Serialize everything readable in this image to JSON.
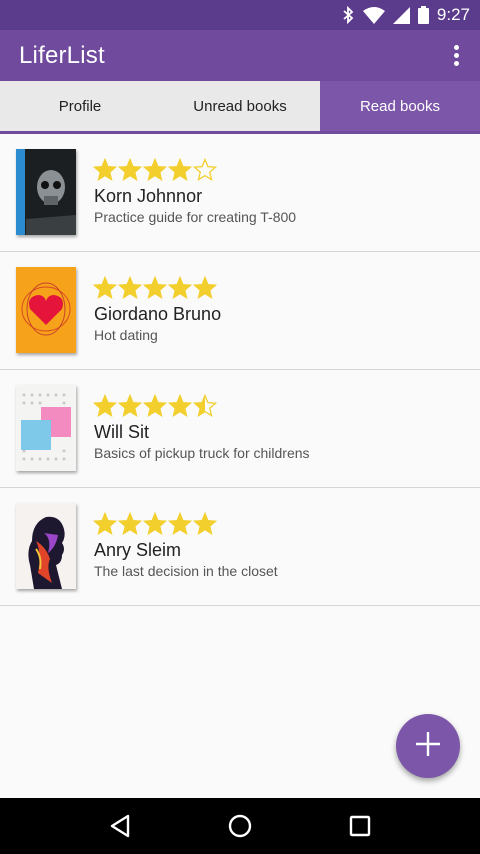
{
  "status_bar": {
    "time": "9:27",
    "icons": [
      "bluetooth-icon",
      "wifi-icon",
      "cell-signal-icon",
      "battery-icon"
    ]
  },
  "app_bar": {
    "title": "LiferList",
    "menu_icon": "more-vert-icon"
  },
  "tabs": [
    {
      "label": "Profile",
      "active": false
    },
    {
      "label": "Unread books",
      "active": false
    },
    {
      "label": "Read books",
      "active": true
    }
  ],
  "books": [
    {
      "rating": 4,
      "rating_max": 5,
      "author": "Korn Johnnor",
      "title": "Practice guide for creating T-800",
      "cover": "skull"
    },
    {
      "rating": 5,
      "rating_max": 5,
      "author": "Giordano Bruno",
      "title": "Hot dating",
      "cover": "heart"
    },
    {
      "rating": 4.5,
      "rating_max": 5,
      "author": "Will Sit",
      "title": "Basics of pickup truck for childrens",
      "cover": "squares"
    },
    {
      "rating": 5,
      "rating_max": 5,
      "author": "Anry Sleim",
      "title": "The last decision in the closet",
      "cover": "silhouette"
    }
  ],
  "fab": {
    "icon": "add-icon"
  },
  "nav_bar": {
    "icons": [
      "back-icon",
      "home-icon",
      "recents-icon"
    ]
  },
  "colors": {
    "status_bar": "#5b3b8c",
    "app_bar": "#6f4a9d",
    "active_tab": "#7c56a8",
    "star": "#f2cf2c",
    "fab": "#7c56a8"
  }
}
